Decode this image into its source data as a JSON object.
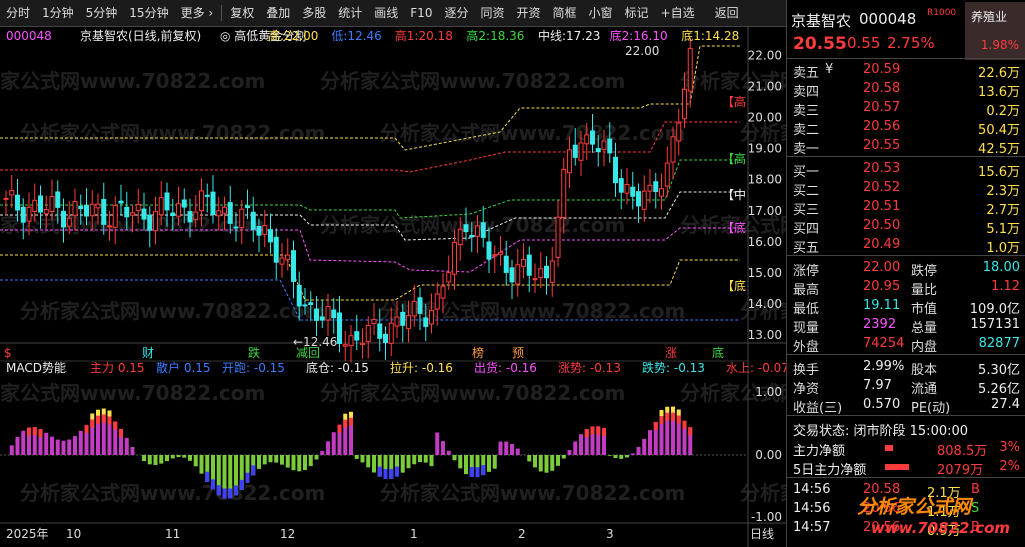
{
  "toolbar": {
    "left": [
      "分时",
      "1分钟",
      "5分钟",
      "15分钟",
      "更多 ›"
    ],
    "middle": [
      "复权",
      "叠加",
      "多股",
      "统计",
      "画线",
      "F10",
      "逐分",
      "同资",
      "开资",
      "简框",
      "小窗",
      "标记",
      "+自选",
      "返回"
    ]
  },
  "stock": {
    "code": "000048",
    "name": "京基智农",
    "badge": "R1000",
    "sector": "养殖业",
    "price": "20.55",
    "change": "0.55",
    "pct": "2.75%",
    "sector_pct": "1.98%"
  },
  "chart_title": {
    "code": "000048",
    "name": "京基智农",
    "mode": "(日线,前复权)",
    "indicator": "高低黄金分割",
    "items": [
      {
        "label": "高:",
        "value": "22.00",
        "color": "#ffe04a"
      },
      {
        "label": "低:",
        "value": "12.46",
        "color": "#3d7bff"
      },
      {
        "label": "高1:",
        "value": "20.18",
        "color": "#ff3b3b"
      },
      {
        "label": "高2:",
        "value": "18.36",
        "color": "#3dd63d"
      },
      {
        "label": "中线:",
        "value": "17.23",
        "color": "#eeeeee"
      },
      {
        "label": "底2:",
        "value": "16.10",
        "color": "#ff52ff"
      },
      {
        "label": "底1:",
        "value": "14.28",
        "color": "#ffe04a"
      }
    ]
  },
  "right_labels": [
    {
      "text": "【高",
      "color": "#ff3b3b"
    },
    {
      "text": "【高",
      "color": "#3dd63d"
    },
    {
      "text": "【中",
      "color": "#eeeeee"
    },
    {
      "text": "【底",
      "color": "#ff52ff"
    },
    {
      "text": "【底",
      "color": "#ffe04a"
    }
  ],
  "price_axis": [
    "22.00",
    "21.00",
    "20.00",
    "19.00",
    "18.00",
    "17.00",
    "16.00",
    "15.00",
    "14.00",
    "13.00"
  ],
  "annotations": {
    "high_mark": "22.00",
    "low_mark": "←12.46"
  },
  "markers": [
    {
      "text": "$",
      "color": "#ff3b3b"
    },
    {
      "text": "财",
      "color": "#37e8e8"
    },
    {
      "text": "跌",
      "color": "#3dd63d"
    },
    {
      "text": "减回",
      "color": "#3dd63d"
    },
    {
      "text": "榜",
      "color": "#ff9a3b"
    },
    {
      "text": "预",
      "color": "#ff9a3b"
    },
    {
      "text": "涨",
      "color": "#ff3b3b"
    },
    {
      "text": "底",
      "color": "#3dd63d"
    }
  ],
  "macd": {
    "title": "MACD势能",
    "items": [
      {
        "label": "主力",
        "value": "0.15",
        "color": "#ff3b3b"
      },
      {
        "label": "散户",
        "value": "0.15",
        "color": "#3d7bff"
      },
      {
        "label": "开跑:",
        "value": "-0.15",
        "color": "#3d7bff"
      },
      {
        "label": "底仓:",
        "value": "-0.15",
        "color": "#eeeeee"
      },
      {
        "label": "拉升:",
        "value": "-0.16",
        "color": "#ffe04a"
      },
      {
        "label": "出货:",
        "value": "-0.16",
        "color": "#ff52ff"
      },
      {
        "label": "涨势:",
        "value": "-0.13",
        "color": "#ff3b3b"
      },
      {
        "label": "跌势:",
        "value": "-0.13",
        "color": "#37e8e8"
      },
      {
        "label": "水上:",
        "value": "-0.07",
        "color": "#ff3b3b"
      }
    ],
    "axis": [
      "1.00",
      "0.00",
      "-1.00"
    ]
  },
  "date_axis": [
    "2025年",
    "10",
    "11",
    "12",
    "1",
    "2",
    "3",
    "日线"
  ],
  "quote": {
    "sell": [
      {
        "label": "卖五",
        "flag": "¥",
        "price": "20.59",
        "vol": "22.6万"
      },
      {
        "label": "卖四",
        "price": "20.58",
        "vol": "13.6万"
      },
      {
        "label": "卖三",
        "price": "20.57",
        "vol": "0.2万"
      },
      {
        "label": "卖二",
        "price": "20.56",
        "vol": "50.4万"
      },
      {
        "label": "卖一",
        "price": "20.55",
        "vol": "42.5万"
      }
    ],
    "buy": [
      {
        "label": "买一",
        "price": "20.53",
        "vol": "15.6万"
      },
      {
        "label": "买二",
        "price": "20.52",
        "vol": "2.3万"
      },
      {
        "label": "买三",
        "price": "20.51",
        "vol": "2.7万"
      },
      {
        "label": "买四",
        "price": "20.50",
        "vol": "5.1万"
      },
      {
        "label": "买五",
        "price": "20.49",
        "vol": "1.0万"
      }
    ],
    "stats": [
      [
        {
          "l": "涨停",
          "v": "22.00",
          "c": "red"
        },
        {
          "l": "跌停",
          "v": "18.00",
          "c": "cyan"
        }
      ],
      [
        {
          "l": "最高",
          "v": "20.95",
          "c": "red"
        },
        {
          "l": "量比",
          "v": "1.12",
          "c": "red"
        }
      ],
      [
        {
          "l": "最低",
          "v": "19.11",
          "c": "cyan"
        },
        {
          "l": "市值",
          "v": "109.0亿",
          "c": "white"
        }
      ],
      [
        {
          "l": "现量",
          "v": "2392",
          "c": "magenta"
        },
        {
          "l": "总量",
          "v": "157131",
          "c": "white"
        }
      ],
      [
        {
          "l": "外盘",
          "v": "74254",
          "c": "red"
        },
        {
          "l": "内盘",
          "v": "82877",
          "c": "cyan"
        }
      ]
    ],
    "fin": [
      [
        {
          "l": "换手",
          "v": "2.99%"
        },
        {
          "l": "股本",
          "v": "5.30亿"
        }
      ],
      [
        {
          "l": "净资",
          "v": "7.97"
        },
        {
          "l": "流通",
          "v": "5.26亿"
        }
      ],
      [
        {
          "l": "收益(三)",
          "v": "0.570"
        },
        {
          "l": "PE(动)",
          "v": "27.4"
        }
      ]
    ],
    "status": "交易状态: 闭市阶段 15:00:00",
    "flows": [
      {
        "label": "主力净额",
        "value": "808.5万",
        "pct": "3%",
        "bar": 0.2
      },
      {
        "label": "5日主力净额",
        "value": "2079万",
        "pct": "2%",
        "bar": 0.6
      }
    ],
    "ticks": [
      {
        "time": "14:56",
        "price": "20.58",
        "vol": "2.1万",
        "side": "B"
      },
      {
        "time": "14:56",
        "price": "20.56",
        "vol": "1.1万",
        "side": "S"
      },
      {
        "time": "14:57",
        "price": "20.56",
        "vol": "0.9万",
        "side": "B"
      }
    ]
  },
  "watermark": {
    "text": "分析家公式网",
    "url": "www.70822.com",
    "bg": "分析家公式网www.70822.com"
  }
}
